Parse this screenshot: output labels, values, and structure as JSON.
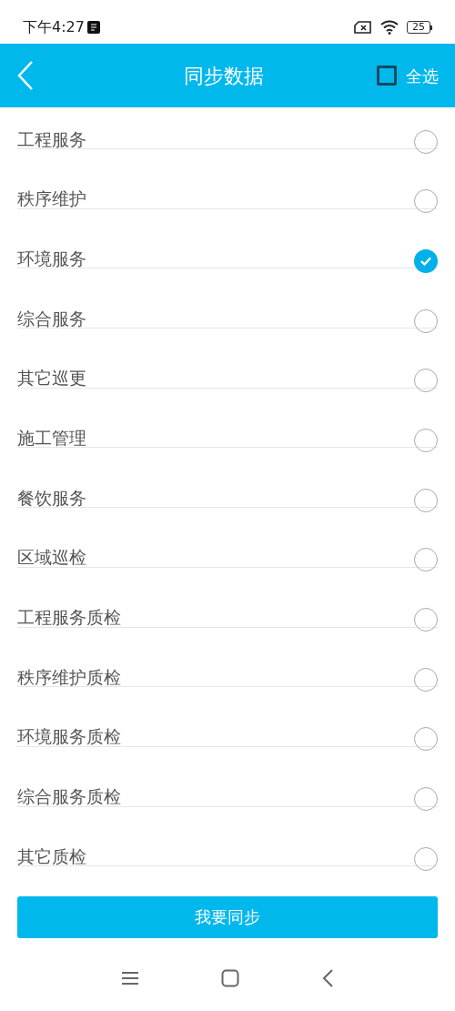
{
  "status_bar": {
    "time": "下午4:27",
    "battery": "25"
  },
  "header": {
    "title": "同步数据",
    "select_all": {
      "label": "全选",
      "checked": false
    }
  },
  "items": [
    {
      "label": "工程服务",
      "checked": false
    },
    {
      "label": "秩序维护",
      "checked": false
    },
    {
      "label": "环境服务",
      "checked": true
    },
    {
      "label": "综合服务",
      "checked": false
    },
    {
      "label": "其它巡更",
      "checked": false
    },
    {
      "label": "施工管理",
      "checked": false
    },
    {
      "label": "餐饮服务",
      "checked": false
    },
    {
      "label": "区域巡检",
      "checked": false
    },
    {
      "label": "工程服务质检",
      "checked": false
    },
    {
      "label": "秩序维护质检",
      "checked": false
    },
    {
      "label": "环境服务质检",
      "checked": false
    },
    {
      "label": "综合服务质检",
      "checked": false
    },
    {
      "label": "其它质检",
      "checked": false
    }
  ],
  "sync_button": "我要同步"
}
